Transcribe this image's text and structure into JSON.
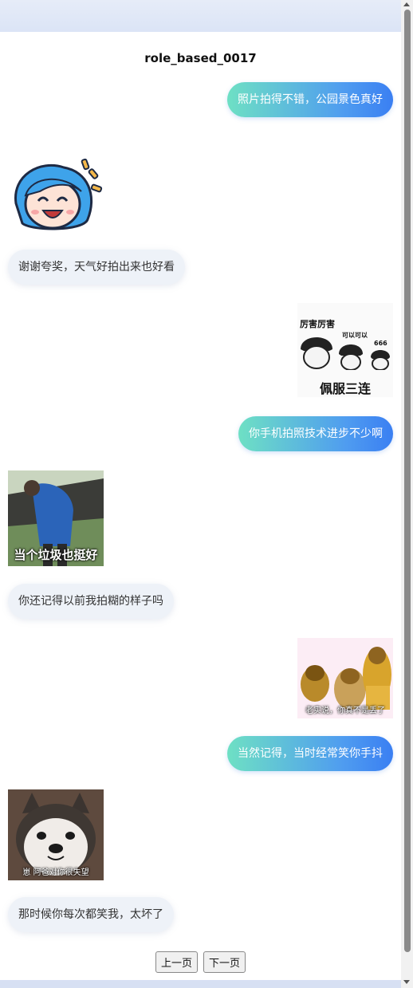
{
  "chat": {
    "title": "role_based_0017",
    "messages": [
      {
        "type": "text",
        "side": "right",
        "text": "照片拍得不错，公园景色真好"
      },
      {
        "type": "sticker",
        "side": "left",
        "icon": "anime-girl-laugh-sticker",
        "caption": ""
      },
      {
        "type": "text",
        "side": "left",
        "text": "谢谢夸奖，天气好拍出来也好看"
      },
      {
        "type": "sticker",
        "side": "right",
        "icon": "meme-admire-sticker",
        "caption": "佩服三连",
        "top_text": "厉害厉害",
        "mid_text": "可以可以",
        "small_text": "666"
      },
      {
        "type": "text",
        "side": "right",
        "text": "你手机拍照技术进步不少啊"
      },
      {
        "type": "sticker",
        "side": "left",
        "icon": "man-hugging-tree-sticker",
        "caption": "当个垃圾也挺好"
      },
      {
        "type": "text",
        "side": "left",
        "text": "你还记得以前我拍糊的样子吗"
      },
      {
        "type": "sticker",
        "side": "right",
        "icon": "golden-buddha-sticker",
        "caption": "老实说，你真不是丢了"
      },
      {
        "type": "text",
        "side": "right",
        "text": "当然记得，当时经常笑你手抖"
      },
      {
        "type": "sticker",
        "side": "left",
        "icon": "husky-dog-sticker",
        "caption": "崽 阿爸对你很失望"
      },
      {
        "type": "text",
        "side": "left",
        "text": "那时候你每次都笑我，太坏了"
      }
    ]
  },
  "pager": {
    "prev_label": "上一页",
    "next_label": "下一页"
  }
}
